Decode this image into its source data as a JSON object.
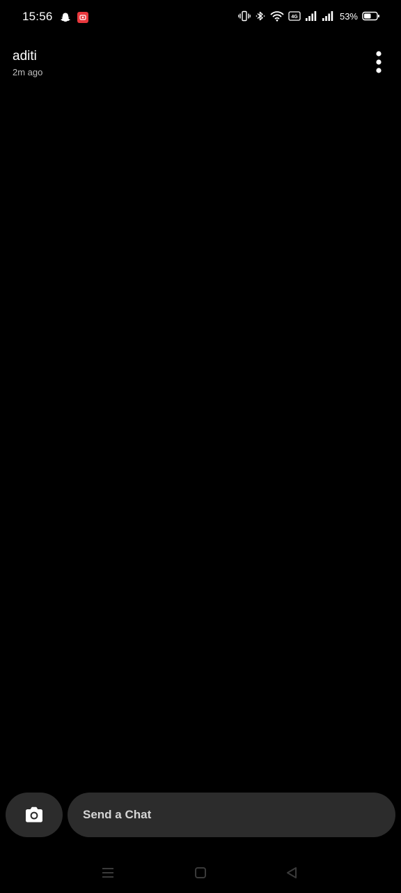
{
  "status_bar": {
    "time": "15:56",
    "battery_percent": "53%",
    "left_icons": [
      "snapchat-ghost-icon",
      "screen-record-icon"
    ],
    "right_icons": [
      "vibrate-icon",
      "bluetooth-icon",
      "wifi-icon",
      "volte-icon",
      "signal-icon",
      "signal-icon",
      "battery-icon"
    ],
    "record_color": "#e8383d"
  },
  "header": {
    "contact_name": "aditi",
    "last_seen": "2m ago",
    "menu_icon": "more-vertical-icon"
  },
  "composer": {
    "camera_icon": "camera-icon",
    "placeholder": "Send a Chat"
  },
  "nav_bar": {
    "icons": [
      "menu-icon",
      "home-icon",
      "back-icon"
    ]
  },
  "colors": {
    "background": "#000000",
    "pill": "#2c2c2c",
    "text": "#ffffff",
    "muted_text": "#bfbfbf"
  }
}
